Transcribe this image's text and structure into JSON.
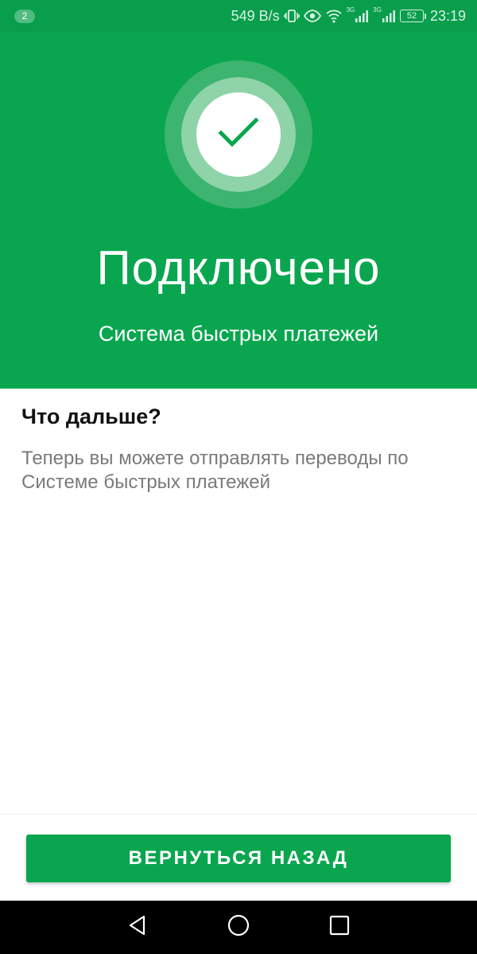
{
  "status_bar": {
    "notification_count": "2",
    "network_speed": "549 B/s",
    "signal_label_1": "3G",
    "signal_label_2": "3G",
    "battery": "52",
    "time": "23:19",
    "icons": [
      "vibrate-icon",
      "eye-icon",
      "wifi-icon",
      "signal-icon",
      "signal-icon",
      "battery-icon"
    ]
  },
  "hero": {
    "icon": "checkmark-icon",
    "title": "Подключено",
    "subtitle": "Система быстрых платежей"
  },
  "info": {
    "title": "Что дальше?",
    "text": "Теперь вы можете отправлять переводы по Системе быстрых платежей"
  },
  "footer": {
    "back_button_label": "ВЕРНУТЬСЯ НАЗАД"
  },
  "nav_bar": {
    "icons": [
      "back-icon",
      "home-icon",
      "recents-icon"
    ]
  },
  "colors": {
    "brand_green": "#09a64f",
    "status_bar": "#089e4c",
    "text_secondary": "#7a7a7a"
  }
}
